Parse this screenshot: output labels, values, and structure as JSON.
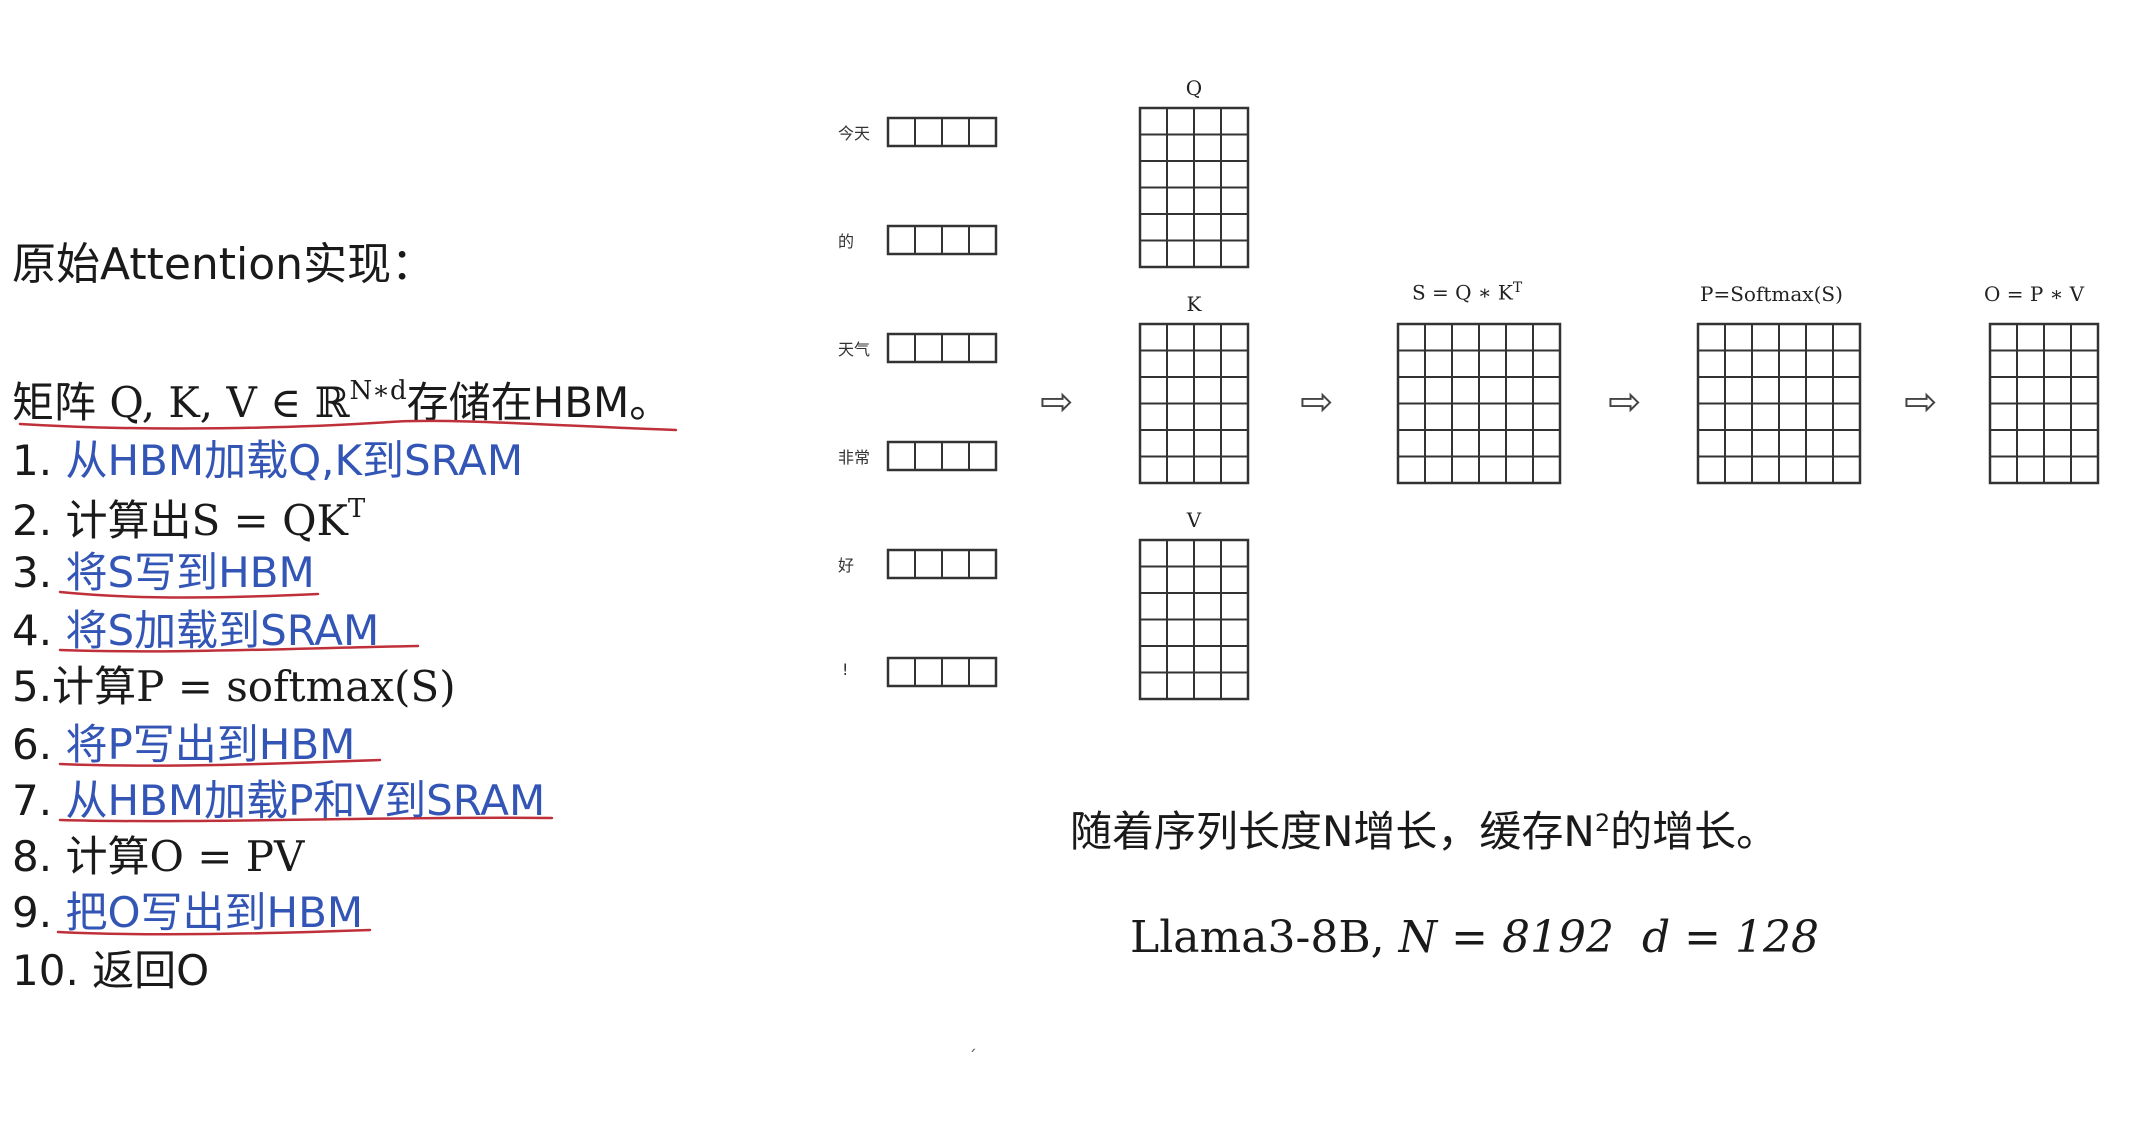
{
  "left": {
    "title": "原始Attention实现：",
    "storage_prefix": "矩阵",
    "storage_vars": "Q, K, V ∈ ℝ",
    "storage_sup": "N∗d",
    "storage_suffix": "存储在HBM。",
    "steps": [
      {
        "num": "1.",
        "text": "从HBM加载Q,K到SRAM",
        "style": "blue"
      },
      {
        "num": "2.",
        "text": "计算出S = QK",
        "sup": "T",
        "style": "black"
      },
      {
        "num": "3.",
        "text": "将S写到HBM",
        "style": "blue"
      },
      {
        "num": "4.",
        "text": "将S加载到SRAM",
        "style": "blue"
      },
      {
        "num": "5.",
        "text": "计算P = softmax(S)",
        "style": "black"
      },
      {
        "num": "6.",
        "text": "将P写出到HBM",
        "style": "blue"
      },
      {
        "num": "7.",
        "text": "从HBM加载P和V到SRAM",
        "style": "blue"
      },
      {
        "num": "8.",
        "text": "计算O = PV",
        "style": "black"
      },
      {
        "num": "9.",
        "text": "把O写出到HBM",
        "style": "blue"
      },
      {
        "num": "10.",
        "text": "返回O",
        "style": "black"
      }
    ]
  },
  "diagram": {
    "tokens": [
      "今天",
      "的",
      "天气",
      "非常",
      "好",
      "!"
    ],
    "matrices": {
      "q": "Q",
      "k": "K",
      "v": "V",
      "s": "S = Q ∗ K",
      "s_sup": "T",
      "p": "P=Softmax(S)",
      "o": "O = P ∗ V"
    },
    "arrow": "⇨"
  },
  "caption": {
    "text_before": "随着序列长度N增长，缓存N",
    "sup": "2",
    "text_after": "的增长。"
  },
  "formula": {
    "model": "Llama3-8B,",
    "n_eq": "N = 8192",
    "d_eq": "d = 128"
  },
  "colors": {
    "blue_text": "#3355b5",
    "underline_red": "#c0303a",
    "grid_line": "#333333"
  }
}
